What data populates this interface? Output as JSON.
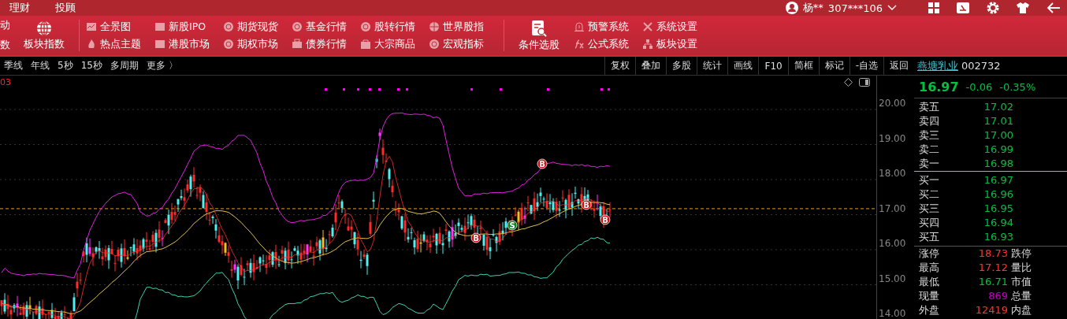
{
  "top_menu": [
    {
      "label": "理财"
    },
    {
      "label": "投顾"
    }
  ],
  "account": {
    "user": "杨**",
    "id": "307***106"
  },
  "toolbar": {
    "cut_items": [
      "动",
      "数"
    ],
    "sector_index": "板块指数",
    "market_items": [
      "全景图",
      "热点主题",
      "新股IPO",
      "港股市场",
      "期货现货",
      "期权市场",
      "基金行情",
      "债券行情",
      "股转行情",
      "大宗商品",
      "世界股指",
      "宏观指标"
    ],
    "stock_picker": "条件选股",
    "system_items": [
      "预警系统",
      "公式系统",
      "系统设置",
      "板块设置"
    ]
  },
  "periods": [
    "季线",
    "年线",
    "5秒",
    "15秒",
    "多周期",
    "更多 〉"
  ],
  "chart_tools": [
    "复权",
    "叠加",
    "多股",
    "统计",
    "画线",
    "F10",
    "简框",
    "标记",
    "-自选",
    "返回"
  ],
  "stock": {
    "name": "燕塘乳业",
    "code": "002732",
    "price": "16.97",
    "change": "-0.06",
    "change_pct": "-0.35%"
  },
  "chart": {
    "indicator_value": "03",
    "y_labels": [
      "20.00",
      "19.00",
      "18.00",
      "17.00",
      "16.00",
      "15.00",
      "14.00"
    ],
    "signals": [
      {
        "label": "B",
        "kind": "buy"
      },
      {
        "label": "B",
        "kind": "buy"
      },
      {
        "label": "S",
        "kind": "sell"
      },
      {
        "label": "B",
        "kind": "buy"
      },
      {
        "label": "B",
        "kind": "buy"
      }
    ]
  },
  "order_book": {
    "asks": [
      {
        "label": "卖五",
        "price": "17.02"
      },
      {
        "label": "卖四",
        "price": "17.01"
      },
      {
        "label": "卖三",
        "price": "17.00"
      },
      {
        "label": "卖二",
        "price": "16.99"
      },
      {
        "label": "卖一",
        "price": "16.98"
      }
    ],
    "bids": [
      {
        "label": "买一",
        "price": "16.97"
      },
      {
        "label": "买二",
        "price": "16.96"
      },
      {
        "label": "买三",
        "price": "16.95"
      },
      {
        "label": "买四",
        "price": "16.94"
      },
      {
        "label": "买五",
        "price": "16.93"
      }
    ]
  },
  "stats": [
    {
      "label": "涨停",
      "value": "18.73",
      "color": "#ff3232",
      "label2": "跌停"
    },
    {
      "label": "最高",
      "value": "17.12",
      "color": "#ff3232",
      "label2": "量比"
    },
    {
      "label": "最低",
      "value": "16.71",
      "color": "#00c040",
      "label2": "市值"
    },
    {
      "label": "现量",
      "value": "869",
      "color": "#c000c0",
      "label2": "总量"
    },
    {
      "label": "外盘",
      "value": "12419",
      "color": "#ff3232",
      "label2": "内盘"
    }
  ]
}
